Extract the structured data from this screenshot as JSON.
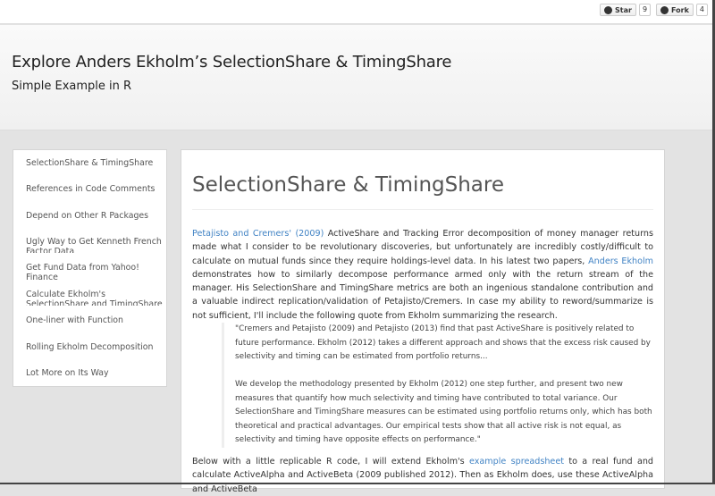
{
  "github": {
    "star_label": "Star",
    "star_count": "9",
    "fork_label": "Fork",
    "fork_count": "4"
  },
  "header": {
    "title": "Explore Anders Ekholm’s SelectionShare & TimingShare",
    "subtitle": "Simple Example in R"
  },
  "sidebar": {
    "items": [
      "SelectionShare & TimingShare",
      "References in Code Comments",
      "Depend on Other R Packages",
      "Ugly Way to Get Kenneth French Factor Data",
      "Get Fund Data from Yahoo! Finance",
      "Calculate Ekholm's SelectionShare and TimingShare",
      "One-liner with Function",
      "Rolling Ekholm Decomposition",
      "Lot More on Its Way"
    ]
  },
  "main": {
    "title": "SelectionShare & TimingShare",
    "p1": {
      "link1": "Petajisto and Cremers' (2009)",
      "t1": " ActiveShare and Tracking Error decomposition of money manager returns made what I consider to be revolutionary discoveries, but unfortunately are incredibly costly/difficult to calculate on mutual funds since they require holdings-level data. In his latest two papers, ",
      "link2": "Anders Ekholm",
      "t2": " demonstrates how to similarly decompose performance armed only with the return stream of the manager. His SelectionShare and TimingShare metrics are both an ingenious standalone contribution and a valuable indirect replication/validation of Petajisto/Cremers. In case my ability to reword/summarize is not sufficient, I'll include the following quote from Ekholm summarizing the research."
    },
    "quote1": " \"Cremers and Petajisto (2009) and Petajisto (2013) find that past ActiveShare is positively related to future performance. Ekholm (2012) takes a different approach and shows that the excess risk caused by selectivity and timing can be estimated from portfolio returns...",
    "quote2": "We develop the methodology presented by Ekholm (2012) one step further, and present two new measures that quantify how much selectivity and timing have contributed to total variance. Our SelectionShare and TimingShare measures can be estimated using portfolio returns only, which has both theoretical and practical advantages. Our empirical tests show that all active risk is not equal, as selectivity and timing have opposite effects on performance.\"",
    "p2": {
      "t1": "Below with a little replicable R code, I will extend Ekholm's ",
      "link": "example spreadsheet",
      "t2": " to a real fund and calculate ActiveAlpha and ActiveBeta (2009 published 2012). Then as Ekholm does, use these ActiveAlpha and ActiveBeta"
    }
  }
}
